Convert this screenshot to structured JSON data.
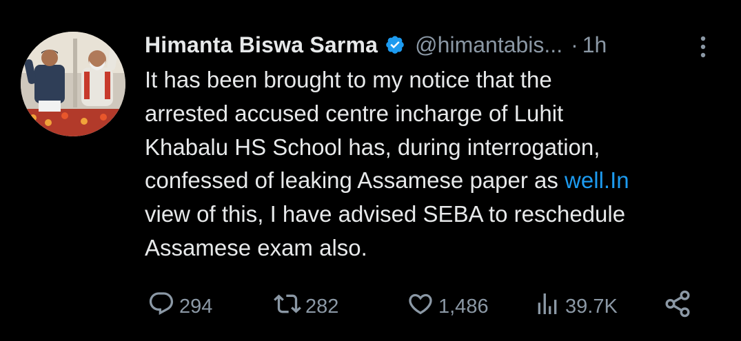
{
  "tweet": {
    "author": {
      "name": "Himanta Biswa Sarma",
      "handle": "@himantabis...",
      "verified": true,
      "separator": "·",
      "time": "1h"
    },
    "text_lines": [
      "It has been brought to my notice that the",
      "arrested accused centre incharge of Luhit",
      "Khabalu HS School has, during interrogation,",
      "confessed of leaking Assamese paper as "
    ],
    "link_text": "well.In",
    "text_lines_after": [
      "view of this, I have advised SEBA to reschedule",
      "Assamese exam also."
    ],
    "actions": {
      "replies": "294",
      "reposts": "282",
      "likes": "1,486",
      "views": "39.7K"
    }
  },
  "colors": {
    "background": "#000000",
    "text": "#e7e9ea",
    "secondary": "#8b98a5",
    "link": "#1d9bf0",
    "verified": "#1d9bf0"
  },
  "icons": {
    "verified": "verified-badge-icon",
    "more": "more-vertical-icon",
    "reply": "reply-icon",
    "repost": "repost-icon",
    "like": "heart-icon",
    "views": "views-chart-icon",
    "share": "share-icon"
  }
}
